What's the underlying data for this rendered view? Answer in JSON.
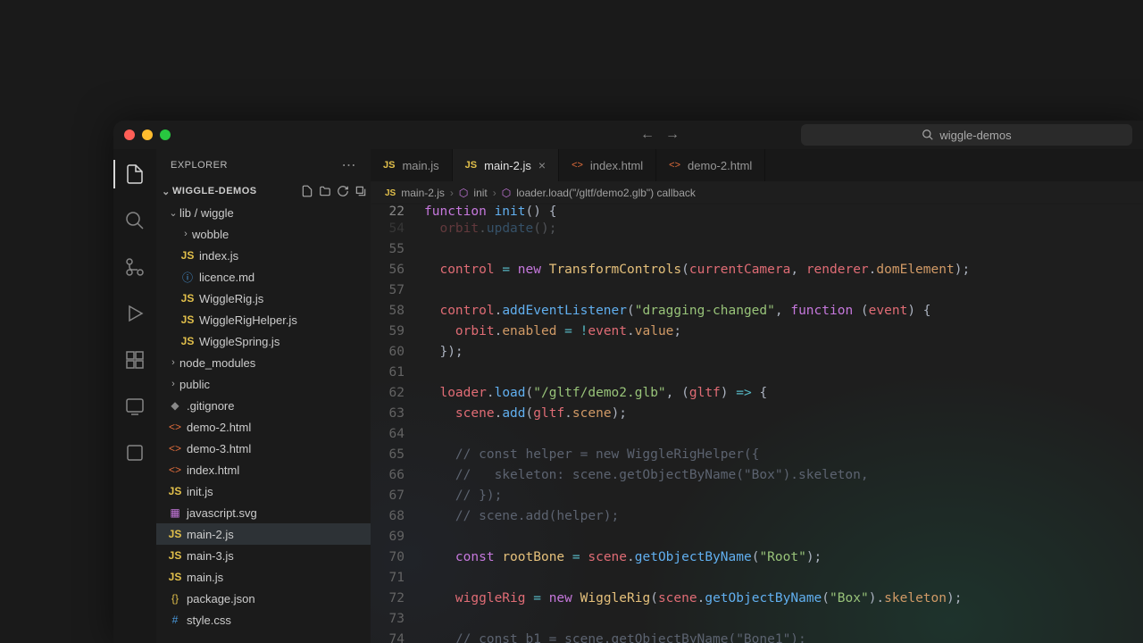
{
  "search": {
    "placeholder": "wiggle-demos"
  },
  "sidebar": {
    "title": "EXPLORER",
    "project": "WIGGLE-DEMOS"
  },
  "tree": {
    "libwiggle": "lib / wiggle",
    "wobble": "wobble",
    "indexjs": "index.js",
    "licence": "licence.md",
    "wigglerig": "WiggleRig.js",
    "wigglerighelper": "WiggleRigHelper.js",
    "wigglespring": "WiggleSpring.js",
    "node_modules": "node_modules",
    "public": "public",
    "gitignore": ".gitignore",
    "demo2": "demo-2.html",
    "demo3": "demo-3.html",
    "indexhtml": "index.html",
    "initjs": "init.js",
    "jssvg": "javascript.svg",
    "main2": "main-2.js",
    "main3": "main-3.js",
    "mainjs": "main.js",
    "package": "package.json",
    "stylecss": "style.css"
  },
  "tabs": {
    "t0": "main.js",
    "t1": "main-2.js",
    "t2": "index.html",
    "t3": "demo-2.html"
  },
  "breadcrumb": {
    "b0": "main-2.js",
    "b1": "init",
    "b2": "loader.load(\"/gltf/demo2.glb\") callback"
  },
  "code": {
    "lineNumbers": [
      "22",
      "54",
      "55",
      "56",
      "57",
      "58",
      "59",
      "60",
      "61",
      "62",
      "63",
      "64",
      "65",
      "66",
      "67",
      "68",
      "69",
      "70",
      "71",
      "72",
      "73",
      "74"
    ],
    "lines": [
      {
        "html": "<span class='kw'>function</span> <span class='fn'>init</span><span class='pn'>()</span> <span class='pn'>{</span>"
      },
      {
        "html": "  <span class='var'>orbit</span><span class='pn'>.</span><span class='fn'>update</span><span class='pn'>();</span>"
      },
      {
        "html": ""
      },
      {
        "html": "  <span class='var'>control</span> <span class='op'>=</span> <span class='kw'>new</span> <span class='def'>TransformControls</span><span class='pn'>(</span><span class='var'>currentCamera</span><span class='pn'>,</span> <span class='var'>renderer</span><span class='pn'>.</span><span class='prop'>domElement</span><span class='pn'>);</span>"
      },
      {
        "html": ""
      },
      {
        "html": "  <span class='var'>control</span><span class='pn'>.</span><span class='fn'>addEventListener</span><span class='pn'>(</span><span class='str'>\"dragging-changed\"</span><span class='pn'>,</span> <span class='kw'>function</span> <span class='pn'>(</span><span class='var'>event</span><span class='pn'>)</span> <span class='pn'>{</span>"
      },
      {
        "html": "    <span class='var'>orbit</span><span class='pn'>.</span><span class='prop'>enabled</span> <span class='op'>=</span> <span class='op'>!</span><span class='var'>event</span><span class='pn'>.</span><span class='prop'>value</span><span class='pn'>;</span>"
      },
      {
        "html": "  <span class='pn'>});</span>"
      },
      {
        "html": ""
      },
      {
        "html": "  <span class='var'>loader</span><span class='pn'>.</span><span class='fn'>load</span><span class='pn'>(</span><span class='str'>\"/gltf/demo2.glb\"</span><span class='pn'>,</span> <span class='pn'>(</span><span class='var'>gltf</span><span class='pn'>)</span> <span class='op'>=&gt;</span> <span class='pn'>{</span>"
      },
      {
        "html": "    <span class='var'>scene</span><span class='pn'>.</span><span class='fn'>add</span><span class='pn'>(</span><span class='var'>gltf</span><span class='pn'>.</span><span class='prop'>scene</span><span class='pn'>);</span>"
      },
      {
        "html": ""
      },
      {
        "html": "    <span class='cmt'>// const helper = new WiggleRigHelper({</span>"
      },
      {
        "html": "    <span class='cmt'>//   skeleton: scene.getObjectByName(\"Box\").skeleton,</span>"
      },
      {
        "html": "    <span class='cmt'>// });</span>"
      },
      {
        "html": "    <span class='cmt'>// scene.add(helper);</span>"
      },
      {
        "html": ""
      },
      {
        "html": "    <span class='kw'>const</span> <span class='def'>rootBone</span> <span class='op'>=</span> <span class='var'>scene</span><span class='pn'>.</span><span class='fn'>getObjectByName</span><span class='pn'>(</span><span class='str'>\"Root\"</span><span class='pn'>);</span>"
      },
      {
        "html": ""
      },
      {
        "html": "    <span class='var'>wiggleRig</span> <span class='op'>=</span> <span class='kw'>new</span> <span class='def'>WiggleRig</span><span class='pn'>(</span><span class='var'>scene</span><span class='pn'>.</span><span class='fn'>getObjectByName</span><span class='pn'>(</span><span class='str'>\"Box\"</span><span class='pn'>).</span><span class='prop'>skeleton</span><span class='pn'>);</span>"
      },
      {
        "html": ""
      },
      {
        "html": "    <span class='cmt'>// const b1 = scene.getObjectByName(\"Bone1\");</span>"
      }
    ]
  }
}
